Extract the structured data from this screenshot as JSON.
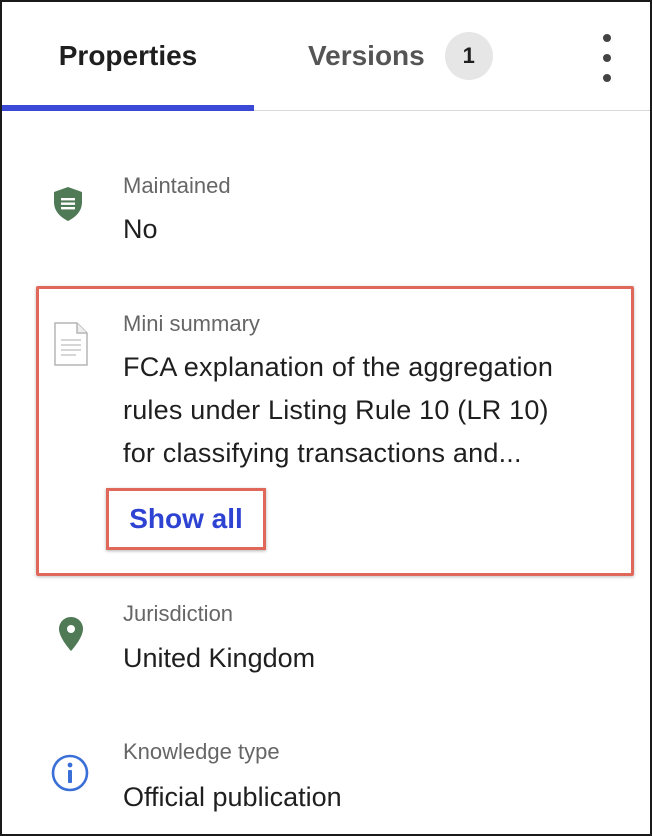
{
  "tabs": {
    "properties": "Properties",
    "versions": "Versions",
    "versions_count": "1"
  },
  "properties": {
    "maintained": {
      "label": "Maintained",
      "value": "No",
      "icon": "shield-icon",
      "icon_color": "#4f7a55"
    },
    "mini_summary": {
      "label": "Mini summary",
      "lines": [
        "FCA explanation of the aggregation",
        "rules under Listing Rule 10 (LR 10)",
        "for classifying transactions and..."
      ],
      "show_all_label": "Show all",
      "icon": "document-icon"
    },
    "jurisdiction": {
      "label": "Jurisdiction",
      "value": "United Kingdom",
      "icon": "location-pin-icon",
      "icon_color": "#4f7a55"
    },
    "knowledge_type": {
      "label": "Knowledge type",
      "value": "Official publication",
      "icon": "info-icon",
      "icon_color": "#3a6fd8"
    }
  },
  "colors": {
    "active_tab_underline": "#3a49d6",
    "link": "#2f43d3",
    "highlight": "#e0685a"
  }
}
